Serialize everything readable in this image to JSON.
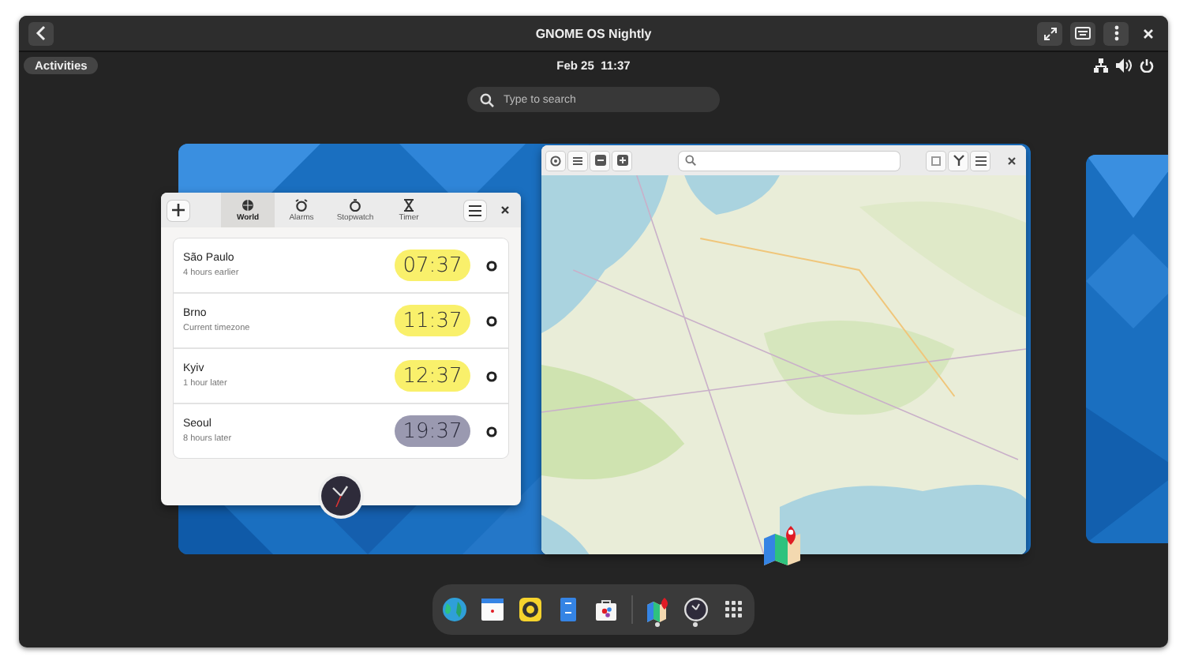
{
  "window": {
    "title": "GNOME OS Nightly"
  },
  "top_bar": {
    "activities": "Activities",
    "clock": "Feb 25  11:37"
  },
  "search": {
    "placeholder": "Type to search"
  },
  "clocks": {
    "tabs": [
      {
        "label": "World",
        "kind": "world",
        "selected": true
      },
      {
        "label": "Alarms",
        "kind": "alarm",
        "selected": false
      },
      {
        "label": "Stopwatch",
        "kind": "stopwatch",
        "selected": false
      },
      {
        "label": "Timer",
        "kind": "timer",
        "selected": false
      }
    ],
    "cities": [
      {
        "name": "São Paulo",
        "detail": "4 hours earlier",
        "time": "07:37",
        "night": false
      },
      {
        "name": "Brno",
        "detail": "Current timezone",
        "time": "11:37",
        "night": false
      },
      {
        "name": "Kyiv",
        "detail": "1 hour later",
        "time": "12:37",
        "night": false
      },
      {
        "name": "Seoul",
        "detail": "8 hours later",
        "time": "19:37",
        "night": true
      }
    ]
  },
  "dock": [
    {
      "kind": "browser",
      "running": false
    },
    {
      "kind": "calendar",
      "running": false
    },
    {
      "kind": "music",
      "running": false
    },
    {
      "kind": "files",
      "running": false
    },
    {
      "kind": "software",
      "running": false
    },
    {
      "kind": "separator"
    },
    {
      "kind": "maps",
      "running": true
    },
    {
      "kind": "clocks",
      "running": true
    },
    {
      "kind": "grid",
      "running": false
    }
  ]
}
